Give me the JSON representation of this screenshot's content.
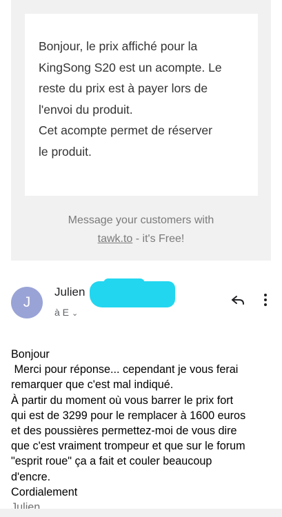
{
  "quoted_message": {
    "text": "Bonjour, le prix affiché pour la\nKingSong S20 est un acompte. Le\nreste du prix est à payer lors de\nl'envoi du produit.\nCet acompte permet de réserver\nle produit.",
    "promo_line1": "Message your customers with",
    "promo_link": "tawk.to",
    "promo_suffix": " - it's Free!"
  },
  "sender": {
    "avatar_letter": "J",
    "name": "Julien",
    "recipient": "à E",
    "avatar_color": "#9aa3d6"
  },
  "body": {
    "lines": "Bonjour\n Merci pour réponse... cependant je vous ferai\nremarquer que c'est mal indiqué.\nÀ partir du moment où vous barrer le prix fort\nqui est de 3299 pour le remplacer à 1600 euros\net des poussières permettez-moi de vous dire\nque c'est vraiment trompeur et que sur le forum\n\"esprit roue\" ça a fait et couler beaucoup\nd'encre.\nCordialement",
    "signature": "Julien"
  },
  "icons": [
    "reply-icon",
    "more-vert-icon",
    "chevron-down-icon"
  ]
}
